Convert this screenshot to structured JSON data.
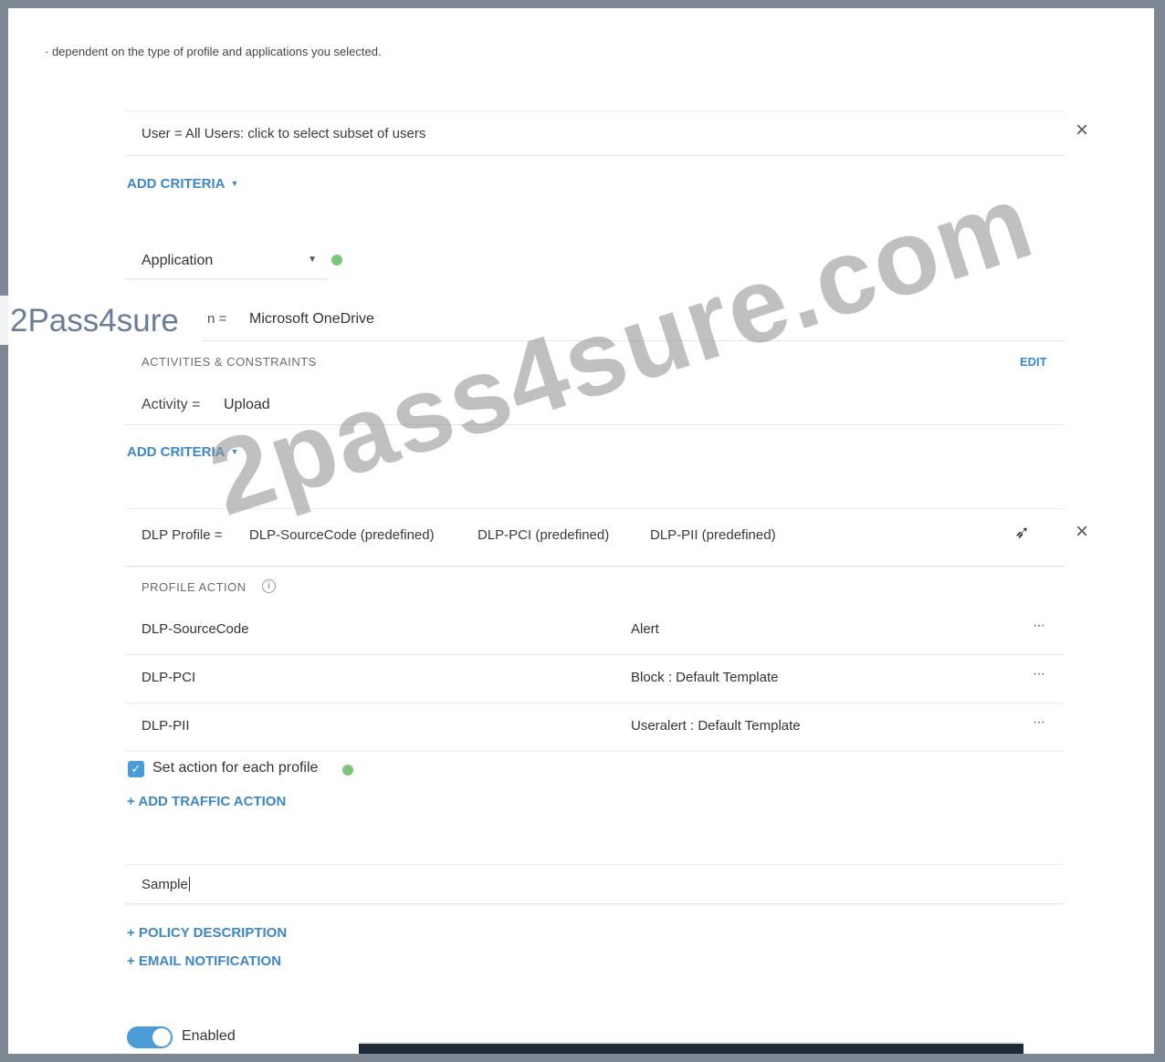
{
  "helper_text": "· dependent on the type of profile and applications you selected.",
  "user_criteria": "User = All Users: click to select subset of users",
  "add_criteria_label": "ADD CRITERIA",
  "application_select": "Application",
  "application": {
    "label": "n =",
    "value": "Microsoft OneDrive"
  },
  "activities": {
    "heading": "ACTIVITIES & CONSTRAINTS",
    "edit_label": "EDIT",
    "activity_label": "Activity =",
    "activity_value": "Upload"
  },
  "dlp": {
    "label": "DLP Profile =",
    "profiles": [
      "DLP-SourceCode (predefined)",
      "DLP-PCI (predefined)",
      "DLP-PII (predefined)"
    ]
  },
  "profile_action": {
    "heading": "PROFILE ACTION",
    "rows": [
      {
        "name": "DLP-SourceCode",
        "action": "Alert"
      },
      {
        "name": "DLP-PCI",
        "action": "Block : Default Template"
      },
      {
        "name": "DLP-PII",
        "action": "Useralert : Default Template"
      }
    ],
    "more_glyph": "···"
  },
  "set_action_label": "Set action for each profile",
  "add_traffic_action": "+ ADD TRAFFIC ACTION",
  "policy_name_value": "Sample",
  "policy_description_link": "+ POLICY DESCRIPTION",
  "email_notification_link": "+ EMAIL NOTIFICATION",
  "enabled_label": "Enabled",
  "overlay": {
    "brand": "2Pass4sure",
    "watermark": "2pass4sure.com"
  },
  "colors": {
    "link": "#3f86c4",
    "accent": "#4a9bd6",
    "status_green": "#7bc67b",
    "frame": "#7d8894"
  },
  "icons": {
    "close": "close-icon",
    "info": "info-icon",
    "check": "checkmark-icon",
    "pointer": "mouse-pointer-icon"
  }
}
